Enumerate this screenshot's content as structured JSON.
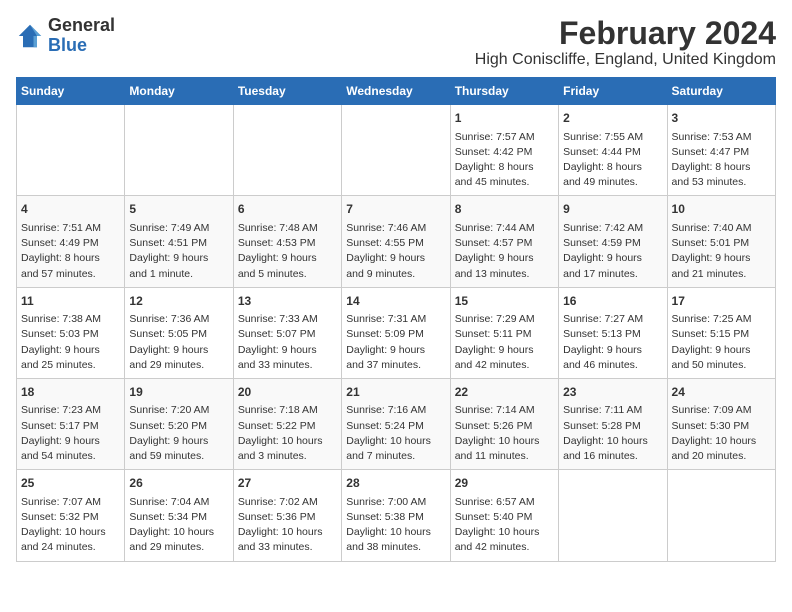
{
  "logo": {
    "general": "General",
    "blue": "Blue"
  },
  "title": "February 2024",
  "subtitle": "High Coniscliffe, England, United Kingdom",
  "weekdays": [
    "Sunday",
    "Monday",
    "Tuesday",
    "Wednesday",
    "Thursday",
    "Friday",
    "Saturday"
  ],
  "weeks": [
    [
      {
        "day": "",
        "info": ""
      },
      {
        "day": "",
        "info": ""
      },
      {
        "day": "",
        "info": ""
      },
      {
        "day": "",
        "info": ""
      },
      {
        "day": "1",
        "info": "Sunrise: 7:57 AM\nSunset: 4:42 PM\nDaylight: 8 hours\nand 45 minutes."
      },
      {
        "day": "2",
        "info": "Sunrise: 7:55 AM\nSunset: 4:44 PM\nDaylight: 8 hours\nand 49 minutes."
      },
      {
        "day": "3",
        "info": "Sunrise: 7:53 AM\nSunset: 4:47 PM\nDaylight: 8 hours\nand 53 minutes."
      }
    ],
    [
      {
        "day": "4",
        "info": "Sunrise: 7:51 AM\nSunset: 4:49 PM\nDaylight: 8 hours\nand 57 minutes."
      },
      {
        "day": "5",
        "info": "Sunrise: 7:49 AM\nSunset: 4:51 PM\nDaylight: 9 hours\nand 1 minute."
      },
      {
        "day": "6",
        "info": "Sunrise: 7:48 AM\nSunset: 4:53 PM\nDaylight: 9 hours\nand 5 minutes."
      },
      {
        "day": "7",
        "info": "Sunrise: 7:46 AM\nSunset: 4:55 PM\nDaylight: 9 hours\nand 9 minutes."
      },
      {
        "day": "8",
        "info": "Sunrise: 7:44 AM\nSunset: 4:57 PM\nDaylight: 9 hours\nand 13 minutes."
      },
      {
        "day": "9",
        "info": "Sunrise: 7:42 AM\nSunset: 4:59 PM\nDaylight: 9 hours\nand 17 minutes."
      },
      {
        "day": "10",
        "info": "Sunrise: 7:40 AM\nSunset: 5:01 PM\nDaylight: 9 hours\nand 21 minutes."
      }
    ],
    [
      {
        "day": "11",
        "info": "Sunrise: 7:38 AM\nSunset: 5:03 PM\nDaylight: 9 hours\nand 25 minutes."
      },
      {
        "day": "12",
        "info": "Sunrise: 7:36 AM\nSunset: 5:05 PM\nDaylight: 9 hours\nand 29 minutes."
      },
      {
        "day": "13",
        "info": "Sunrise: 7:33 AM\nSunset: 5:07 PM\nDaylight: 9 hours\nand 33 minutes."
      },
      {
        "day": "14",
        "info": "Sunrise: 7:31 AM\nSunset: 5:09 PM\nDaylight: 9 hours\nand 37 minutes."
      },
      {
        "day": "15",
        "info": "Sunrise: 7:29 AM\nSunset: 5:11 PM\nDaylight: 9 hours\nand 42 minutes."
      },
      {
        "day": "16",
        "info": "Sunrise: 7:27 AM\nSunset: 5:13 PM\nDaylight: 9 hours\nand 46 minutes."
      },
      {
        "day": "17",
        "info": "Sunrise: 7:25 AM\nSunset: 5:15 PM\nDaylight: 9 hours\nand 50 minutes."
      }
    ],
    [
      {
        "day": "18",
        "info": "Sunrise: 7:23 AM\nSunset: 5:17 PM\nDaylight: 9 hours\nand 54 minutes."
      },
      {
        "day": "19",
        "info": "Sunrise: 7:20 AM\nSunset: 5:20 PM\nDaylight: 9 hours\nand 59 minutes."
      },
      {
        "day": "20",
        "info": "Sunrise: 7:18 AM\nSunset: 5:22 PM\nDaylight: 10 hours\nand 3 minutes."
      },
      {
        "day": "21",
        "info": "Sunrise: 7:16 AM\nSunset: 5:24 PM\nDaylight: 10 hours\nand 7 minutes."
      },
      {
        "day": "22",
        "info": "Sunrise: 7:14 AM\nSunset: 5:26 PM\nDaylight: 10 hours\nand 11 minutes."
      },
      {
        "day": "23",
        "info": "Sunrise: 7:11 AM\nSunset: 5:28 PM\nDaylight: 10 hours\nand 16 minutes."
      },
      {
        "day": "24",
        "info": "Sunrise: 7:09 AM\nSunset: 5:30 PM\nDaylight: 10 hours\nand 20 minutes."
      }
    ],
    [
      {
        "day": "25",
        "info": "Sunrise: 7:07 AM\nSunset: 5:32 PM\nDaylight: 10 hours\nand 24 minutes."
      },
      {
        "day": "26",
        "info": "Sunrise: 7:04 AM\nSunset: 5:34 PM\nDaylight: 10 hours\nand 29 minutes."
      },
      {
        "day": "27",
        "info": "Sunrise: 7:02 AM\nSunset: 5:36 PM\nDaylight: 10 hours\nand 33 minutes."
      },
      {
        "day": "28",
        "info": "Sunrise: 7:00 AM\nSunset: 5:38 PM\nDaylight: 10 hours\nand 38 minutes."
      },
      {
        "day": "29",
        "info": "Sunrise: 6:57 AM\nSunset: 5:40 PM\nDaylight: 10 hours\nand 42 minutes."
      },
      {
        "day": "",
        "info": ""
      },
      {
        "day": "",
        "info": ""
      }
    ]
  ]
}
